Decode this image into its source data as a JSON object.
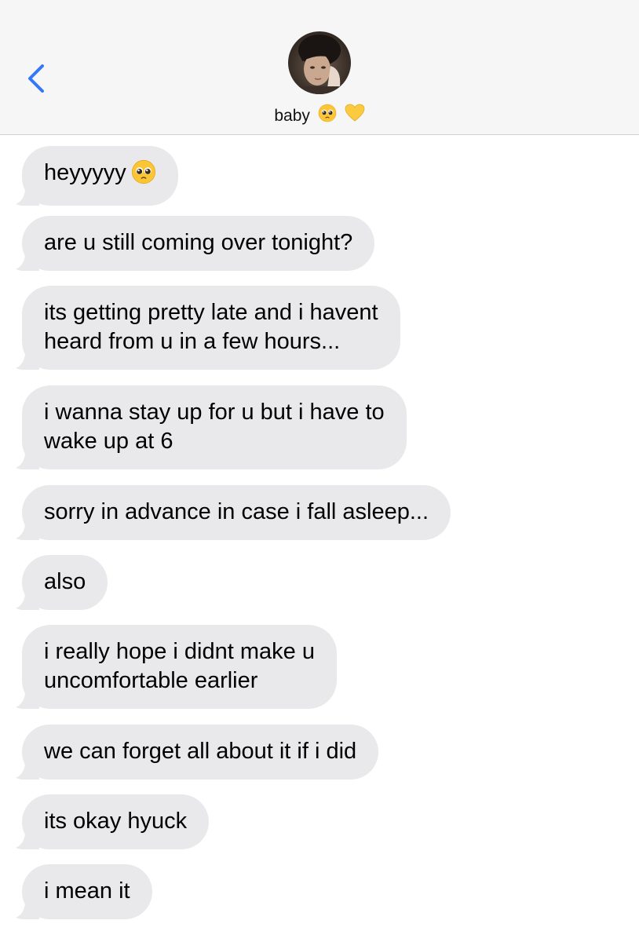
{
  "header": {
    "contact_name": "baby",
    "name_emojis": [
      "pleading-face-emoji",
      "yellow-heart-emoji"
    ],
    "back_icon": "chevron-left-icon",
    "avatar": "contact-avatar"
  },
  "colors": {
    "header_bg": "#f6f6f6",
    "bubble_bg": "#e9e9eb",
    "accent": "#3478f6",
    "text": "#000000"
  },
  "messages": [
    {
      "lines": [
        "heyyyyy"
      ],
      "emoji": "pleading-face-emoji"
    },
    {
      "lines": [
        "are u still coming over tonight?"
      ]
    },
    {
      "lines": [
        "its getting pretty late and i havent",
        "heard from u in a few hours..."
      ]
    },
    {
      "lines": [
        "i wanna stay up for u but i have to",
        "wake up at 6"
      ]
    },
    {
      "lines": [
        "sorry in advance in case i fall asleep..."
      ]
    },
    {
      "lines": [
        "also"
      ]
    },
    {
      "lines": [
        "i really hope i didnt make u",
        "uncomfortable earlier"
      ]
    },
    {
      "lines": [
        "we can forget all about it if i did"
      ]
    },
    {
      "lines": [
        "its okay hyuck"
      ]
    },
    {
      "lines": [
        "i mean it"
      ]
    }
  ]
}
